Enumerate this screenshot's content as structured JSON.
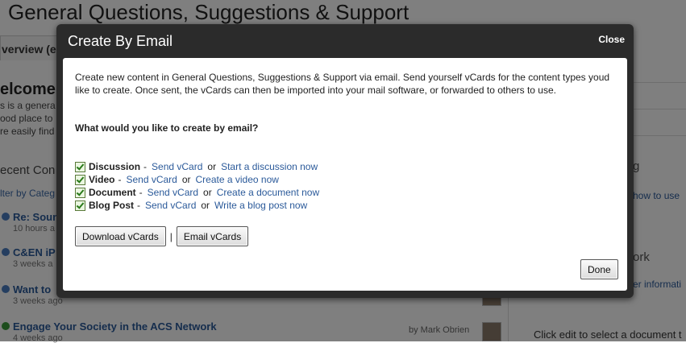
{
  "background": {
    "page_title": "General Questions, Suggestions & Support",
    "overview_tab": "verview (e",
    "welcome": "elcome",
    "intro_lines": [
      "s is a genera",
      "ood place to",
      "re easily find"
    ],
    "recent_heading": "ecent Con",
    "filter": "lter by Categ",
    "items": [
      {
        "title": "Re: Soun",
        "meta": "10 hours a"
      },
      {
        "title": "C&EN iP",
        "meta": "3 weeks a"
      },
      {
        "title": "Want to",
        "meta": "3 weeks ago"
      },
      {
        "title": "Engage Your Society in the ACS Network",
        "meta": "4 weeks ago"
      }
    ],
    "by_author": "by Mark Obrien",
    "right": {
      "how_to": "how to use",
      "g_frag": "g",
      "network_frag": "ork",
      "info_link": "er informati",
      "edit_text": "Click edit to select a document t"
    }
  },
  "modal": {
    "title": "Create By Email",
    "close_label": "Close",
    "intro": "Create new content in General Questions, Suggestions & Support via email. Send yourself vCards for the content types youd like to create. Once sent, the vCards can then be imported into your mail software, or forwarded to others to use.",
    "question": "What would you like to create by email?",
    "options": [
      {
        "name": "Discussion",
        "send": "Send vCard",
        "or": "or",
        "action": "Start a discussion now",
        "checked": true
      },
      {
        "name": "Video",
        "send": "Send vCard",
        "or": "or",
        "action": "Create a video now",
        "checked": true
      },
      {
        "name": "Document",
        "send": "Send vCard",
        "or": "or",
        "action": "Create a document now",
        "checked": true
      },
      {
        "name": "Blog Post",
        "send": "Send vCard",
        "or": "or",
        "action": "Write a blog post now",
        "checked": true
      }
    ],
    "dash": "-",
    "download_label": "Download vCards",
    "separator": "|",
    "email_label": "Email vCards",
    "done_label": "Done"
  },
  "colors": {
    "link": "#2b5a9a",
    "modal_frame": "#2b2b2b",
    "overlay": "rgba(0,0,0,0.5)"
  }
}
